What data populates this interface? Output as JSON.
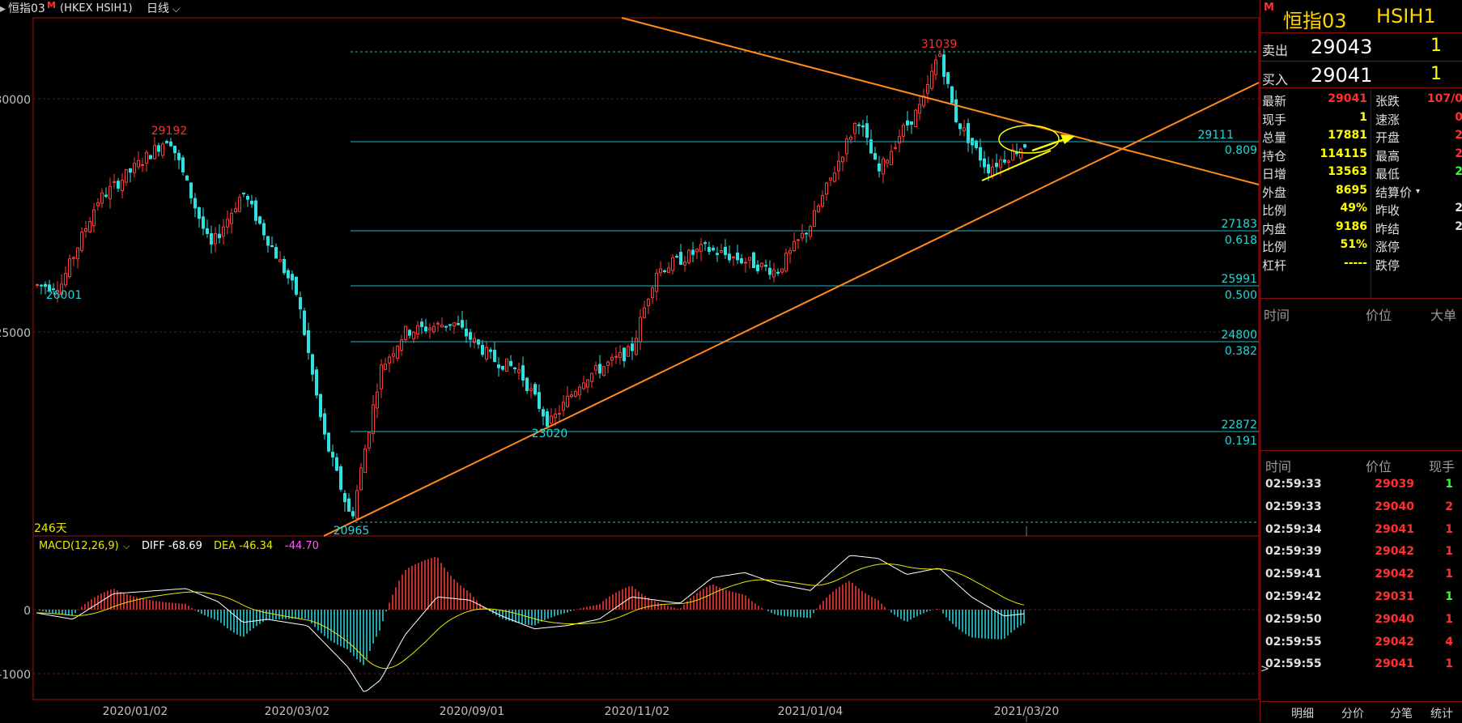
{
  "header": {
    "symbol_name": "恒指03",
    "market_marker": "M",
    "code": "(HKEX HSIH1)",
    "period": "日线"
  },
  "chart_labels": {
    "days_label": "246天",
    "y_tick_labels": [
      "30000",
      "25000"
    ],
    "macd_y_labels": [
      "0",
      "-1000"
    ],
    "date_labels": [
      "2020/01/02",
      "2020/03/02",
      "2020/09/01",
      "2020/11/02",
      "2021/01/04",
      "2021/03/20"
    ],
    "fib_levels": [
      {
        "price": "29111",
        "ratio": "0.809"
      },
      {
        "price": "27183",
        "ratio": "0.618"
      },
      {
        "price": "25991",
        "ratio": "0.500"
      },
      {
        "price": "24800",
        "ratio": "0.382"
      },
      {
        "price": "22872",
        "ratio": "0.191"
      }
    ],
    "extreme_labels": {
      "high1": "29192",
      "low1": "26001",
      "low_main": "20965",
      "low2": "23020",
      "high_main": "31039"
    }
  },
  "macd": {
    "title": "MACD(12,26,9)",
    "diff": "DIFF -68.69",
    "dea": "DEA -46.34",
    "macd": "-44.70"
  },
  "quote": {
    "title_name": "恒指03",
    "title_code": "HSIH1",
    "sell_label": "卖出",
    "sell_price": "29043",
    "sell_qty": "1",
    "buy_label": "买入",
    "buy_price": "29041",
    "buy_qty": "1",
    "fields_left": [
      {
        "label": "最新",
        "value": "29041",
        "color": "#ff3030"
      },
      {
        "label": "现手",
        "value": "1",
        "color": "#ffff00"
      },
      {
        "label": "总量",
        "value": "17881",
        "color": "#ffff00"
      },
      {
        "label": "持仓",
        "value": "114115",
        "color": "#ffff00"
      },
      {
        "label": "日增",
        "value": "13563",
        "color": "#ffff00"
      },
      {
        "label": "外盘",
        "value": "8695",
        "color": "#ffff00"
      },
      {
        "label": "比例",
        "value": "49%",
        "color": "#ffff00"
      },
      {
        "label": "内盘",
        "value": "9186",
        "color": "#ffff00"
      },
      {
        "label": "比例",
        "value": "51%",
        "color": "#ffff00"
      },
      {
        "label": "杠杆",
        "value": "-----",
        "color": "#ffff00"
      }
    ],
    "fields_right": [
      {
        "label": "张跌",
        "value": "107/0",
        "color": "#ff3030"
      },
      {
        "label": "速涨",
        "value": "0",
        "color": "#ff3030"
      },
      {
        "label": "开盘",
        "value": "2",
        "color": "#ff3030"
      },
      {
        "label": "最高",
        "value": "2",
        "color": "#ff3030"
      },
      {
        "label": "最低",
        "value": "2",
        "color": "#30ff30"
      },
      {
        "label": "结算价",
        "value": "",
        "color": "#ffff00"
      },
      {
        "label": "昨收",
        "value": "2",
        "color": "#e0e0e0"
      },
      {
        "label": "昨结",
        "value": "2",
        "color": "#e0e0e0"
      },
      {
        "label": "涨停",
        "value": "",
        "color": "#e0e0e0"
      },
      {
        "label": "跌停",
        "value": "",
        "color": "#e0e0e0"
      }
    ]
  },
  "big_orders": {
    "headers": [
      "时间",
      "价位",
      "大单"
    ]
  },
  "ticks": {
    "headers": [
      "时间",
      "价位",
      "现手"
    ],
    "rows": [
      {
        "time": "02:59:33",
        "price": "29039",
        "vol": "1",
        "vol_color": "#30ff30"
      },
      {
        "time": "02:59:33",
        "price": "29040",
        "vol": "2",
        "vol_color": "#ff3030"
      },
      {
        "time": "02:59:34",
        "price": "29041",
        "vol": "1",
        "vol_color": "#ff3030"
      },
      {
        "time": "02:59:39",
        "price": "29042",
        "vol": "1",
        "vol_color": "#ff3030"
      },
      {
        "time": "02:59:41",
        "price": "29042",
        "vol": "1",
        "vol_color": "#ff3030"
      },
      {
        "time": "02:59:42",
        "price": "29031",
        "vol": "1",
        "vol_color": "#30ff30"
      },
      {
        "time": "02:59:50",
        "price": "29040",
        "vol": "1",
        "vol_color": "#ff3030"
      },
      {
        "time": "02:59:55",
        "price": "29042",
        "vol": "4",
        "vol_color": "#ff3030"
      },
      {
        "time": "02:59:55",
        "price": "29041",
        "vol": "1",
        "vol_color": "#ff3030"
      }
    ]
  },
  "tabs": [
    "明细",
    "分价",
    "分笔",
    "统计"
  ],
  "chart_data": {
    "type": "candlestick",
    "title": "",
    "y_price_range": [
      20000,
      31500
    ],
    "price_path": [
      {
        "date": "2020/01/02",
        "close": 26000
      },
      {
        "date": "2020/01/20",
        "close": 29192
      },
      {
        "date": "2020/03/02",
        "close": 27500
      },
      {
        "date": "2020/03/19",
        "close": 20965
      },
      {
        "date": "2020/06/09",
        "close": 25300
      },
      {
        "date": "2020/08/01",
        "close": 24400
      },
      {
        "date": "2020/09/01",
        "close": 23020
      },
      {
        "date": "2020/11/02",
        "close": 24800
      },
      {
        "date": "2020/11/20",
        "close": 26500
      },
      {
        "date": "2021/01/04",
        "close": 27300
      },
      {
        "date": "2021/02/18",
        "close": 31039
      },
      {
        "date": "2021/03/20",
        "close": 29041
      }
    ],
    "fibonacci": [
      {
        "ratio": 0.191,
        "price": 22872
      },
      {
        "ratio": 0.382,
        "price": 24800
      },
      {
        "ratio": 0.5,
        "price": 25991
      },
      {
        "ratio": 0.618,
        "price": 27183
      },
      {
        "ratio": 0.809,
        "price": 29111
      }
    ],
    "macd": {
      "diff": -68.69,
      "dea": -46.34,
      "macd": -44.7,
      "y_range": [
        -1800,
        1000
      ]
    }
  }
}
